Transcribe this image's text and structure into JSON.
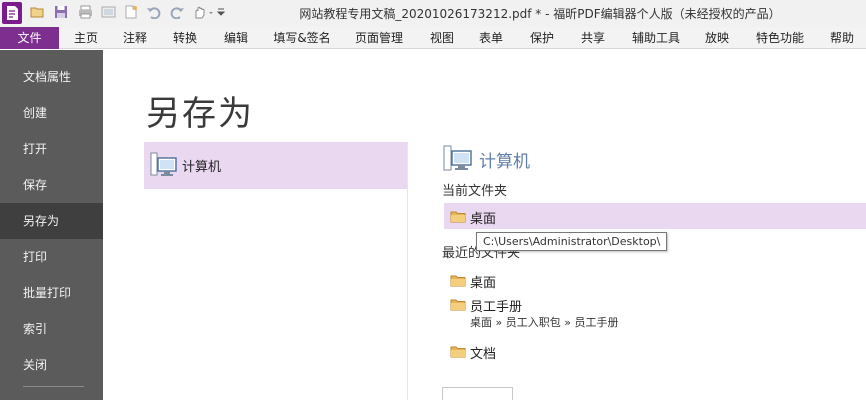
{
  "window": {
    "title": "网站教程专用文稿_20201026173212.pdf * - 福昕PDF编辑器个人版（未经授权的产品）"
  },
  "quick_access": [
    {
      "name": "folder-open-icon"
    },
    {
      "name": "save-icon"
    },
    {
      "name": "print-icon"
    },
    {
      "name": "scan-icon"
    },
    {
      "name": "new-icon"
    },
    {
      "name": "undo-icon"
    },
    {
      "name": "redo-icon"
    },
    {
      "name": "hand-tool-icon"
    },
    {
      "name": "customize-icon"
    }
  ],
  "ribbon": {
    "tabs": [
      "文件",
      "主页",
      "注释",
      "转换",
      "编辑",
      "填写&签名",
      "页面管理",
      "视图",
      "表单",
      "保护",
      "共享",
      "辅助工具",
      "放映",
      "特色功能",
      "帮助"
    ]
  },
  "nav": {
    "items": [
      "文档属性",
      "创建",
      "打开",
      "保存",
      "另存为",
      "打印",
      "批量打印",
      "索引",
      "关闭"
    ],
    "active": "另存为"
  },
  "main": {
    "title": "另存为",
    "location": "计算机",
    "right_title": "计算机",
    "current_folder_label": "当前文件夹",
    "current_folder": "桌面",
    "recent_label": "最近的文件夹",
    "recent": [
      {
        "name": "桌面",
        "path": ""
      },
      {
        "name": "员工手册",
        "path": "桌面 » 员工入职包 » 员工手册"
      },
      {
        "name": "文档",
        "path": ""
      }
    ],
    "tooltip": "C:\\Users\\Administrator\\Desktop\\"
  },
  "colors": {
    "accent": "#7c2f8e",
    "selection": "#ead7f0",
    "nav_bg": "#5b5b5b",
    "nav_active": "#3f3f3f",
    "heading_blue": "#5f7fa8",
    "folder": "#e8b45a"
  }
}
